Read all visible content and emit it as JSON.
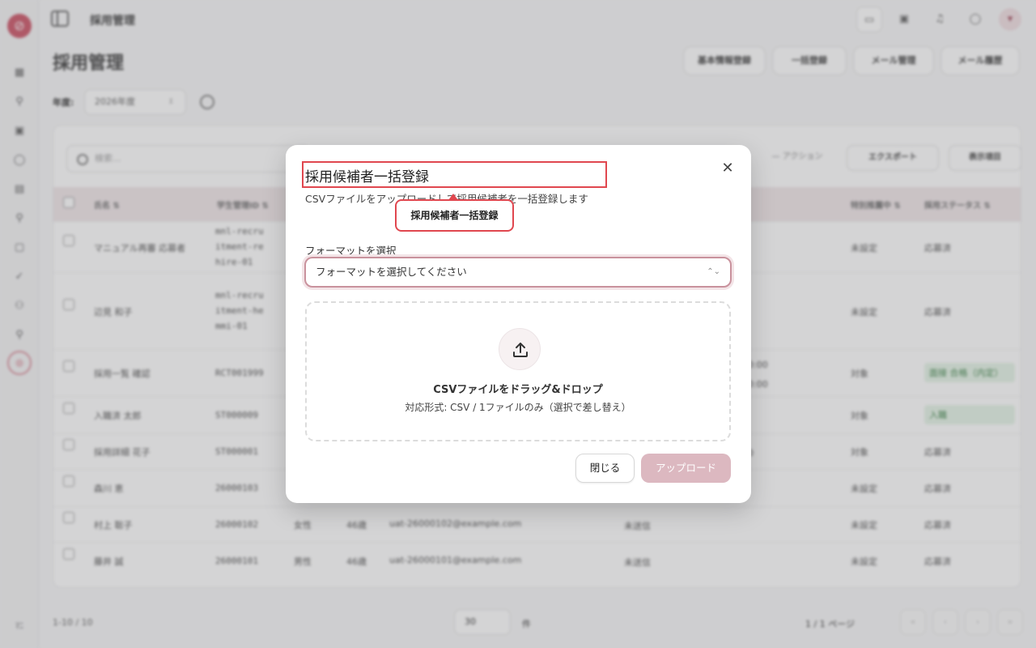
{
  "app": {
    "logo_glyph": "⊘",
    "header_title": "採用管理",
    "page_title": "採用管理",
    "sidebar_user": "ﾏﾆ",
    "sidebar_active_glyph": "👥",
    "sidebar_icons": [
      "dashboard-icon",
      "user-icon",
      "calendar-icon",
      "chat-icon",
      "document-icon",
      "person-icon",
      "file-icon",
      "check-icon",
      "users-icon",
      "user-add-icon"
    ],
    "header_buttons": [
      "基本情報登録",
      "一括登録",
      "メール管理",
      "メール履歴"
    ],
    "year_label": "年度:",
    "year_value": "2026年度",
    "search_placeholder": "検索...",
    "toolbar": {
      "action": "— アクション",
      "export": "エクスポート",
      "columns": "表示項目"
    },
    "table": {
      "headers": [
        "氏名 ⇅",
        "学生管理ID ⇅",
        "特別推薦中 ⇅",
        "採用ステータス ⇅"
      ],
      "rows": [
        {
          "name": "マニュアル再審 応募者",
          "id": "mnl-recru\nitment-re\nhire-01",
          "gender": "",
          "age": "",
          "email": "",
          "date": "",
          "special": "未設定",
          "status": "応募済",
          "green": false
        },
        {
          "name": "辺見 和子",
          "id": "mnl-recru\nitment-he\nmmi-01",
          "gender": "",
          "age": "",
          "email": "",
          "date": "",
          "special": "未設定",
          "status": "応募済",
          "green": false
        },
        {
          "name": "採用一覧 確認",
          "id": "RCT001999",
          "gender": "",
          "age": "",
          "email": "",
          "date": "0:00\n0:00",
          "special": "対象",
          "status": "面接 合格（内定）",
          "green": true
        },
        {
          "name": "入職済 太郎",
          "id": "ST000009",
          "gender": "",
          "age": "",
          "email": "",
          "date": "",
          "special": "対象",
          "status": "入職",
          "green": true
        },
        {
          "name": "採用詳細 花子",
          "id": "ST000001",
          "gender": "",
          "age": "",
          "email": "",
          "date": "0",
          "special": "対象",
          "status": "応募済",
          "green": false
        },
        {
          "name": "森川 恵",
          "id": "26000103",
          "gender": "",
          "age": "",
          "email": "",
          "date": "",
          "special": "未設定",
          "status": "応募済",
          "green": false
        },
        {
          "name": "村上 聡子",
          "id": "26000102",
          "gender": "女性",
          "age": "46歳",
          "email": "uat-26000102@example.com",
          "date": "未送信",
          "special": "未設定",
          "status": "応募済",
          "green": false
        },
        {
          "name": "藤井 誠",
          "id": "26000101",
          "gender": "男性",
          "age": "46歳",
          "email": "uat-26000101@example.com",
          "date": "未送信",
          "special": "未設定",
          "status": "応募済",
          "green": false
        }
      ]
    },
    "footer": {
      "count": "1-10 / 10",
      "per_page": "30",
      "per_unit": "件",
      "page_info": "1 / 1 ページ"
    }
  },
  "modal": {
    "title": "採用候補者一括登録",
    "description": "CSVファイルをアップロードして採用候補者を一括登録します",
    "tooltip": "採用候補者一括登録",
    "close_glyph": "✕",
    "format_label": "フォーマットを選択",
    "format_placeholder": "フォーマットを選択してください",
    "dropzone_title": "CSVファイルをドラッグ&ドロップ",
    "dropzone_sub": "対応形式: CSV / 1ファイルのみ（選択で差し替え）",
    "close_button": "閉じる",
    "upload_button": "アップロード"
  }
}
